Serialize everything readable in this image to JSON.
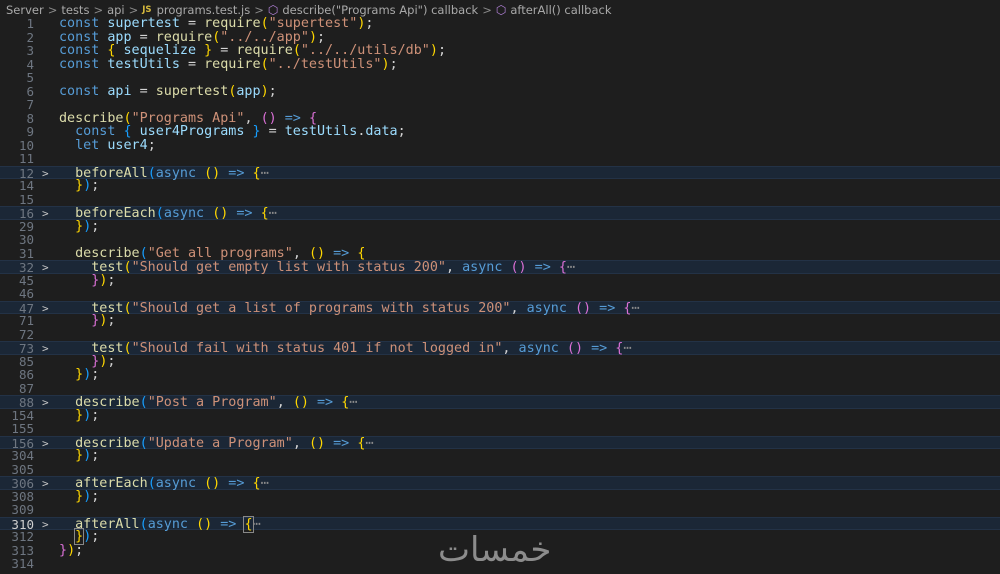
{
  "breadcrumb": {
    "items": [
      "Server",
      "tests",
      "api",
      "programs.test.js",
      "describe(\"Programs Api\") callback",
      "afterAll() callback"
    ],
    "file_badge": "JS",
    "separator": ">"
  },
  "editor": {
    "fold_ellipsis": "⋯",
    "fold_chevron": ">",
    "lines": [
      {
        "n": "1",
        "t": [
          [
            "k",
            "const "
          ],
          [
            "v",
            "supertest"
          ],
          [
            "p",
            " = "
          ],
          [
            "f",
            "require"
          ],
          [
            "y",
            "("
          ],
          [
            "s",
            "\"supertest\""
          ],
          [
            "y",
            ")"
          ],
          [
            "p",
            ";"
          ]
        ]
      },
      {
        "n": "2",
        "t": [
          [
            "k",
            "const "
          ],
          [
            "v",
            "app"
          ],
          [
            "p",
            " = "
          ],
          [
            "f",
            "require"
          ],
          [
            "y",
            "("
          ],
          [
            "s",
            "\"../../app\""
          ],
          [
            "y",
            ")"
          ],
          [
            "p",
            ";"
          ]
        ]
      },
      {
        "n": "3",
        "t": [
          [
            "k",
            "const "
          ],
          [
            "y",
            "{ "
          ],
          [
            "v",
            "sequelize"
          ],
          [
            "y",
            " }"
          ],
          [
            "p",
            " = "
          ],
          [
            "f",
            "require"
          ],
          [
            "y",
            "("
          ],
          [
            "s",
            "\"../../utils/db\""
          ],
          [
            "y",
            ")"
          ],
          [
            "p",
            ";"
          ]
        ]
      },
      {
        "n": "4",
        "t": [
          [
            "k",
            "const "
          ],
          [
            "v",
            "testUtils"
          ],
          [
            "p",
            " = "
          ],
          [
            "f",
            "require"
          ],
          [
            "y",
            "("
          ],
          [
            "s",
            "\"../testUtils\""
          ],
          [
            "y",
            ")"
          ],
          [
            "p",
            ";"
          ]
        ]
      },
      {
        "n": "5",
        "t": []
      },
      {
        "n": "6",
        "t": [
          [
            "k",
            "const "
          ],
          [
            "v",
            "api"
          ],
          [
            "p",
            " = "
          ],
          [
            "f",
            "supertest"
          ],
          [
            "y",
            "("
          ],
          [
            "v",
            "app"
          ],
          [
            "y",
            ")"
          ],
          [
            "p",
            ";"
          ]
        ]
      },
      {
        "n": "7",
        "t": []
      },
      {
        "n": "8",
        "t": [
          [
            "f",
            "describe"
          ],
          [
            "y",
            "("
          ],
          [
            "s",
            "\"Programs Api\""
          ],
          [
            "p",
            ", "
          ],
          [
            "m",
            "()"
          ],
          [
            "k",
            " => "
          ],
          [
            "m",
            "{"
          ]
        ]
      },
      {
        "n": "9",
        "t": [
          [
            "p",
            "  "
          ],
          [
            "k",
            "const "
          ],
          [
            "b",
            "{ "
          ],
          [
            "v",
            "user4Programs"
          ],
          [
            "b",
            " }"
          ],
          [
            "p",
            " = "
          ],
          [
            "v",
            "testUtils"
          ],
          [
            "p",
            "."
          ],
          [
            "v",
            "data"
          ],
          [
            "p",
            ";"
          ]
        ]
      },
      {
        "n": "10",
        "t": [
          [
            "p",
            "  "
          ],
          [
            "k",
            "let "
          ],
          [
            "v",
            "user4"
          ],
          [
            "p",
            ";"
          ]
        ]
      },
      {
        "n": "11",
        "t": []
      },
      {
        "n": "12",
        "fold": true,
        "t": [
          [
            "p",
            "  "
          ],
          [
            "f",
            "beforeAll"
          ],
          [
            "b",
            "("
          ],
          [
            "k",
            "async "
          ],
          [
            "y",
            "()"
          ],
          [
            "k",
            " => "
          ],
          [
            "y",
            "{"
          ]
        ]
      },
      {
        "n": "14",
        "t": [
          [
            "p",
            "  "
          ],
          [
            "y",
            "}"
          ],
          [
            "b",
            ")"
          ],
          [
            "p",
            ";"
          ]
        ]
      },
      {
        "n": "15",
        "t": []
      },
      {
        "n": "16",
        "fold": true,
        "t": [
          [
            "p",
            "  "
          ],
          [
            "f",
            "beforeEach"
          ],
          [
            "b",
            "("
          ],
          [
            "k",
            "async "
          ],
          [
            "y",
            "()"
          ],
          [
            "k",
            " => "
          ],
          [
            "y",
            "{"
          ]
        ]
      },
      {
        "n": "29",
        "t": [
          [
            "p",
            "  "
          ],
          [
            "y",
            "}"
          ],
          [
            "b",
            ")"
          ],
          [
            "p",
            ";"
          ]
        ]
      },
      {
        "n": "30",
        "t": []
      },
      {
        "n": "31",
        "t": [
          [
            "p",
            "  "
          ],
          [
            "f",
            "describe"
          ],
          [
            "b",
            "("
          ],
          [
            "s",
            "\"Get all programs\""
          ],
          [
            "p",
            ", "
          ],
          [
            "y",
            "()"
          ],
          [
            "k",
            " => "
          ],
          [
            "y",
            "{"
          ]
        ]
      },
      {
        "n": "32",
        "fold": true,
        "t": [
          [
            "p",
            "    "
          ],
          [
            "f",
            "test"
          ],
          [
            "y",
            "("
          ],
          [
            "s",
            "\"Should get empty list with status 200\""
          ],
          [
            "p",
            ", "
          ],
          [
            "k",
            "async "
          ],
          [
            "m",
            "()"
          ],
          [
            "k",
            " => "
          ],
          [
            "m",
            "{"
          ]
        ]
      },
      {
        "n": "45",
        "t": [
          [
            "p",
            "    "
          ],
          [
            "m",
            "}"
          ],
          [
            "y",
            ")"
          ],
          [
            "p",
            ";"
          ]
        ]
      },
      {
        "n": "46",
        "t": []
      },
      {
        "n": "47",
        "fold": true,
        "t": [
          [
            "p",
            "    "
          ],
          [
            "f",
            "test"
          ],
          [
            "y",
            "("
          ],
          [
            "s",
            "\"Should get a list of programs with status 200\""
          ],
          [
            "p",
            ", "
          ],
          [
            "k",
            "async "
          ],
          [
            "m",
            "()"
          ],
          [
            "k",
            " => "
          ],
          [
            "m",
            "{"
          ]
        ]
      },
      {
        "n": "71",
        "t": [
          [
            "p",
            "    "
          ],
          [
            "m",
            "}"
          ],
          [
            "y",
            ")"
          ],
          [
            "p",
            ";"
          ]
        ]
      },
      {
        "n": "72",
        "t": []
      },
      {
        "n": "73",
        "fold": true,
        "t": [
          [
            "p",
            "    "
          ],
          [
            "f",
            "test"
          ],
          [
            "y",
            "("
          ],
          [
            "s",
            "\"Should fail with status 401 if not logged in\""
          ],
          [
            "p",
            ", "
          ],
          [
            "k",
            "async "
          ],
          [
            "m",
            "()"
          ],
          [
            "k",
            " => "
          ],
          [
            "m",
            "{"
          ]
        ]
      },
      {
        "n": "85",
        "t": [
          [
            "p",
            "    "
          ],
          [
            "m",
            "}"
          ],
          [
            "y",
            ")"
          ],
          [
            "p",
            ";"
          ]
        ]
      },
      {
        "n": "86",
        "t": [
          [
            "p",
            "  "
          ],
          [
            "y",
            "}"
          ],
          [
            "b",
            ")"
          ],
          [
            "p",
            ";"
          ]
        ]
      },
      {
        "n": "87",
        "t": []
      },
      {
        "n": "88",
        "fold": true,
        "t": [
          [
            "p",
            "  "
          ],
          [
            "f",
            "describe"
          ],
          [
            "b",
            "("
          ],
          [
            "s",
            "\"Post a Program\""
          ],
          [
            "p",
            ", "
          ],
          [
            "y",
            "()"
          ],
          [
            "k",
            " => "
          ],
          [
            "y",
            "{"
          ]
        ]
      },
      {
        "n": "154",
        "t": [
          [
            "p",
            "  "
          ],
          [
            "y",
            "}"
          ],
          [
            "b",
            ")"
          ],
          [
            "p",
            ";"
          ]
        ]
      },
      {
        "n": "155",
        "t": []
      },
      {
        "n": "156",
        "fold": true,
        "t": [
          [
            "p",
            "  "
          ],
          [
            "f",
            "describe"
          ],
          [
            "b",
            "("
          ],
          [
            "s",
            "\"Update a Program\""
          ],
          [
            "p",
            ", "
          ],
          [
            "y",
            "()"
          ],
          [
            "k",
            " => "
          ],
          [
            "y",
            "{"
          ]
        ]
      },
      {
        "n": "304",
        "t": [
          [
            "p",
            "  "
          ],
          [
            "y",
            "}"
          ],
          [
            "b",
            ")"
          ],
          [
            "p",
            ";"
          ]
        ]
      },
      {
        "n": "305",
        "t": []
      },
      {
        "n": "306",
        "fold": true,
        "t": [
          [
            "p",
            "  "
          ],
          [
            "f",
            "afterEach"
          ],
          [
            "b",
            "("
          ],
          [
            "k",
            "async "
          ],
          [
            "y",
            "()"
          ],
          [
            "k",
            " => "
          ],
          [
            "y",
            "{"
          ]
        ]
      },
      {
        "n": "308",
        "t": [
          [
            "p",
            "  "
          ],
          [
            "y",
            "}"
          ],
          [
            "b",
            ")"
          ],
          [
            "p",
            ";"
          ]
        ]
      },
      {
        "n": "309",
        "t": []
      },
      {
        "n": "310",
        "fold": true,
        "current": true,
        "t": [
          [
            "p",
            "  "
          ],
          [
            "f",
            "afterAll"
          ],
          [
            "b",
            "("
          ],
          [
            "k",
            "async "
          ],
          [
            "y",
            "()"
          ],
          [
            "k",
            " => "
          ],
          [
            "y hl",
            "{"
          ]
        ]
      },
      {
        "n": "312",
        "t": [
          [
            "p",
            "  "
          ],
          [
            "y hl",
            "}"
          ],
          [
            "b",
            ")"
          ],
          [
            "p",
            ";"
          ]
        ]
      },
      {
        "n": "313",
        "t": [
          [
            "m",
            "}"
          ],
          [
            "y",
            ")"
          ],
          [
            "p",
            ";"
          ]
        ]
      },
      {
        "n": "314",
        "t": []
      }
    ]
  },
  "watermark": "خمسات"
}
